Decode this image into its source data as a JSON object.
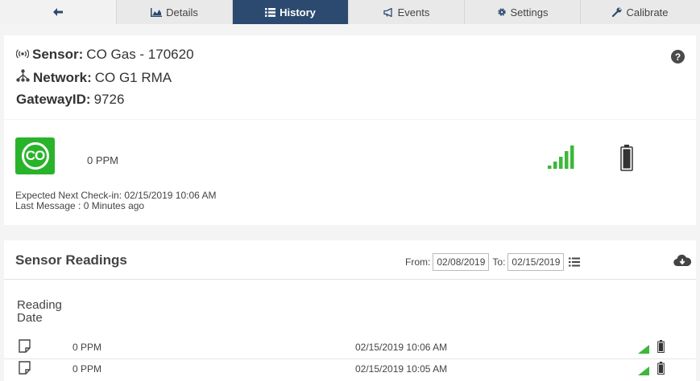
{
  "tabs": [
    {
      "label": "",
      "icon": "back-arrow-icon"
    },
    {
      "label": "Details",
      "icon": "area-chart-icon"
    },
    {
      "label": "History",
      "icon": "list-icon",
      "active": true
    },
    {
      "label": "Events",
      "icon": "bullhorn-icon"
    },
    {
      "label": "Settings",
      "icon": "gear-icon"
    },
    {
      "label": "Calibrate",
      "icon": "wrench-icon"
    }
  ],
  "sensor": {
    "sensor_label": "Sensor:",
    "sensor_name": "CO Gas - 170620",
    "network_label": "Network:",
    "network_name": "CO G1 RMA",
    "gateway_label": "GatewayID:",
    "gateway_id": "9726"
  },
  "status": {
    "badge_text": "CO",
    "reading": "0 PPM",
    "next_checkin": "Expected Next Check-in: 02/15/2019 10:06 AM",
    "last_message": "Last Message : 0 Minutes ago",
    "signal_bars_lit": 5,
    "signal_bars_total": 5
  },
  "readings": {
    "title": "Sensor Readings",
    "from_label": "From:",
    "from_value": "02/08/2019",
    "to_label": "To:",
    "to_value": "02/15/2019",
    "column_header": "Reading Date",
    "rows": [
      {
        "value": "0 PPM",
        "date": "02/15/2019 10:06 AM"
      },
      {
        "value": "0 PPM",
        "date": "02/15/2019 10:05 AM"
      }
    ]
  },
  "colors": {
    "active_tab": "#2c4a70",
    "status_green": "#29b32b",
    "signal_green": "#3cb83a"
  }
}
